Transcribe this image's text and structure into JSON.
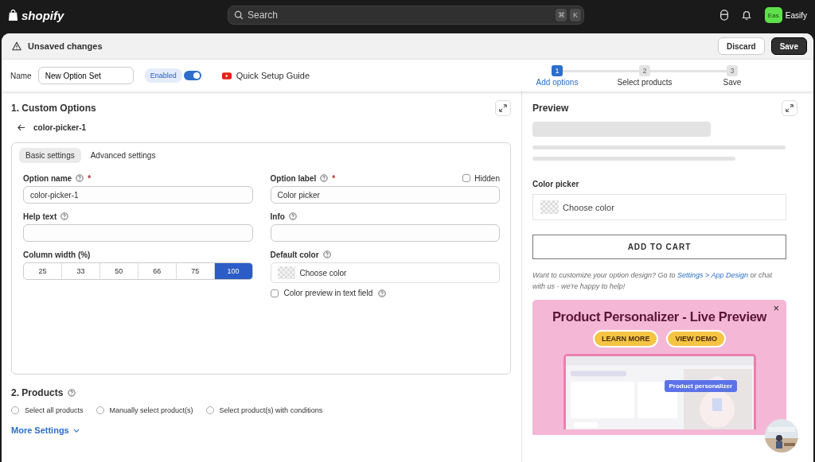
{
  "topbar": {
    "logo": "shopify",
    "search": {
      "placeholder": "Search",
      "keys": [
        "⌘",
        "K"
      ]
    },
    "store_initials": "Eas",
    "store_name": "Easify"
  },
  "save_bar": {
    "title": "Unsaved changes",
    "buttons": [
      {
        "label": "Discard",
        "kind": "secondary"
      },
      {
        "label": "Save",
        "kind": "primary"
      }
    ]
  },
  "header": {
    "name_label": "Name",
    "name_value": "New Option Set",
    "enabled_label": "Enabled",
    "enabled_on": true,
    "guide": "Quick Setup Guide",
    "steps": [
      {
        "number": "1",
        "label": "Add options",
        "selected": true
      },
      {
        "number": "2",
        "label": "Select products",
        "selected": false
      },
      {
        "number": "3",
        "label": "Save",
        "selected": false
      }
    ]
  },
  "custom_options": {
    "title": "1. Custom Options",
    "back_label": "color-picker-1",
    "tabs": [
      {
        "label": "Basic settings",
        "selected": true
      },
      {
        "label": "Advanced settings",
        "selected": false
      }
    ],
    "option_name": {
      "label": "Option name",
      "required_mark": "*",
      "value": "color-picker-1"
    },
    "option_label": {
      "label": "Option label",
      "required_mark": "*",
      "value": "Color picker",
      "hidden_label": "Hidden",
      "hidden_checked": false
    },
    "help_text": {
      "label": "Help text"
    },
    "info": {
      "label": "Info"
    },
    "column_width": {
      "label": "Column width (%)",
      "options": [
        {
          "label": "25",
          "selected": false
        },
        {
          "label": "33",
          "selected": false
        },
        {
          "label": "50",
          "selected": false
        },
        {
          "label": "66",
          "selected": false
        },
        {
          "label": "75",
          "selected": false
        },
        {
          "label": "100",
          "selected": true
        }
      ]
    },
    "default_color": {
      "label": "Default color",
      "button": "Choose color"
    },
    "color_preview": {
      "label": "Color preview in text field",
      "checked": false
    }
  },
  "products": {
    "title": "2. Products",
    "options": [
      {
        "label": "Select all products",
        "selected": false
      },
      {
        "label": "Manually select product(s)",
        "selected": false
      },
      {
        "label": "Select product(s) with conditions",
        "selected": false
      }
    ]
  },
  "more_settings": "More Settings",
  "preview": {
    "title": "Preview",
    "field_label": "Color picker",
    "choose": "Choose color",
    "add_to_cart": "ADD TO CART",
    "note_before": "Want to customize your option design? Go to",
    "note_link": "Settings > App Design",
    "note_after": "or chat with us - we're happy to help!",
    "banner": {
      "title": "Product Personalizer - Live Preview",
      "buttons": [
        "LEARN MORE",
        "VIEW DEMO"
      ],
      "tag": "Product personalizer",
      "close": "×"
    }
  }
}
